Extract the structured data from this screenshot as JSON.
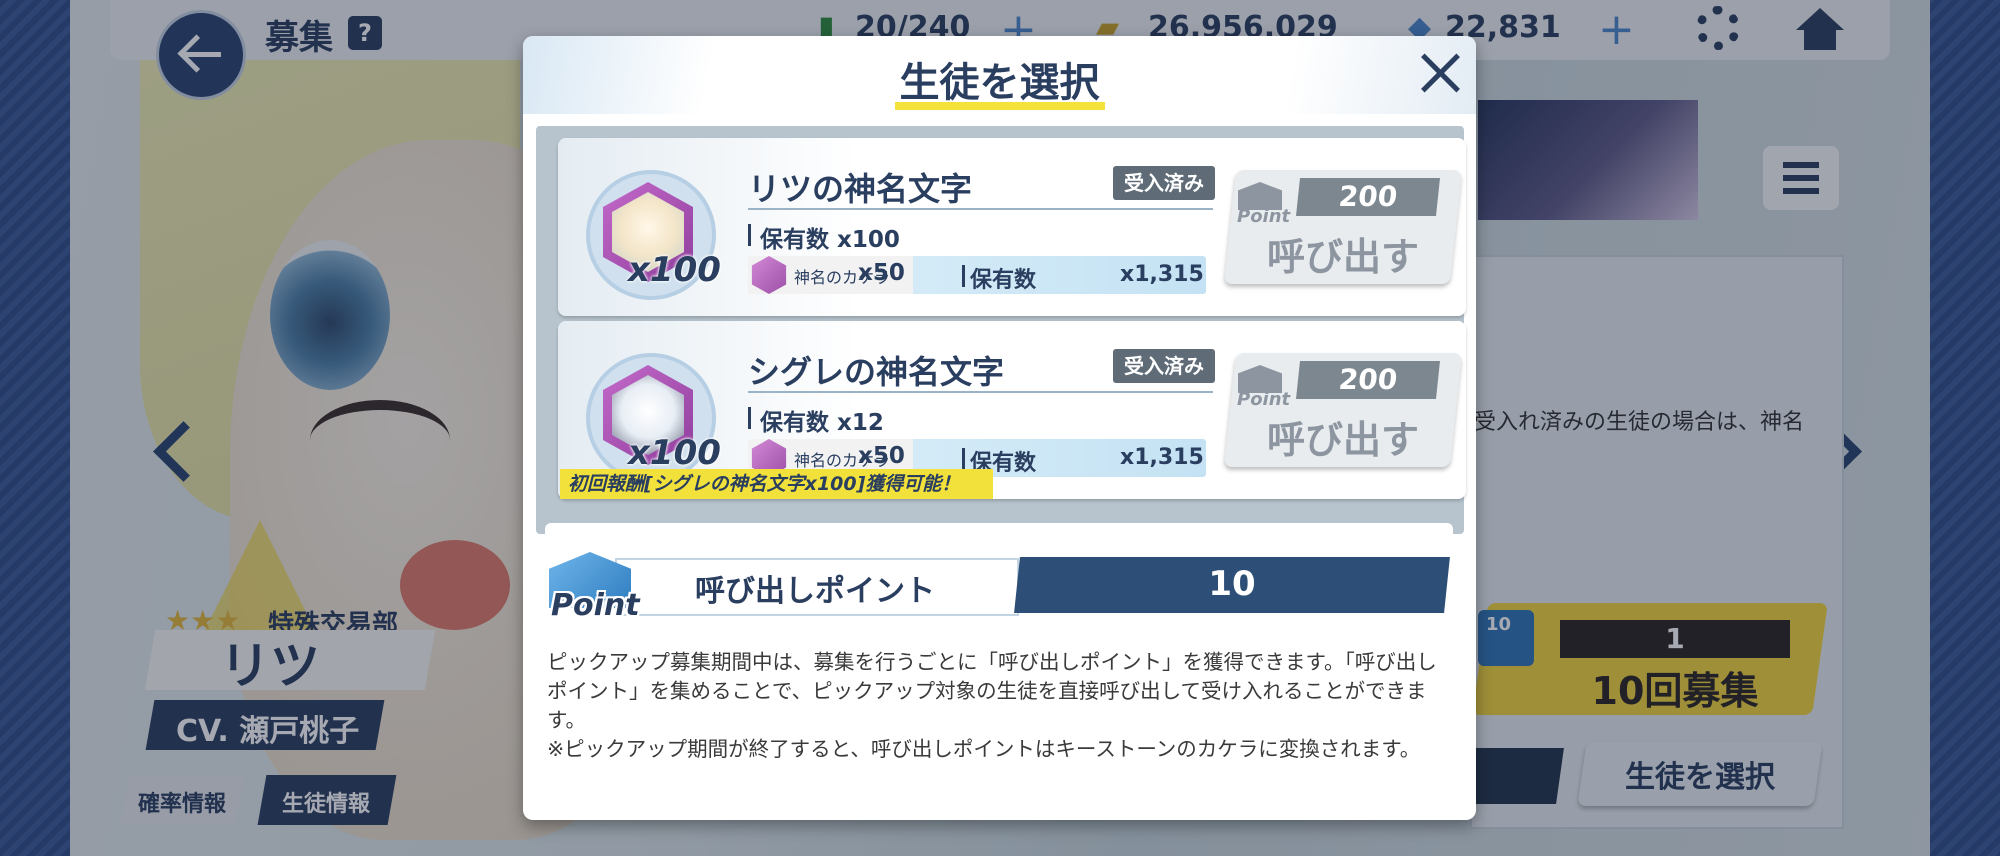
{
  "header": {
    "title": "募集",
    "help": "?",
    "ap": "20/240",
    "credits": "26,956,029",
    "pyroxene": "22,831"
  },
  "character": {
    "stars": "★★★",
    "school": "特殊交易部",
    "name": "リツ",
    "cv": "CV. 瀬戸桃子",
    "tab_rate": "確率情報",
    "tab_student": "生徒情報"
  },
  "side": {
    "partial_text": "受入れ済みの生徒の場合は、神名",
    "ten_count": "1",
    "ten_badge": "10",
    "ten_label": "10回募集",
    "select_label": "生徒を選択"
  },
  "modal": {
    "title": "生徒を選択",
    "items": [
      {
        "multiplier": "x100",
        "name": "リツの神名文字",
        "badge": "受入済み",
        "owned": "保有数 x100",
        "eleph_name": "神名のカケラ",
        "eleph_count": "x50",
        "eleph_owned_label": "保有数",
        "eleph_owned": "x1,315",
        "point_icon_label": "Point",
        "cost": "200",
        "button": "呼び出す"
      },
      {
        "multiplier": "x100",
        "name": "シグレの神名文字",
        "badge": "受入済み",
        "owned": "保有数 x12",
        "eleph_name": "神名のカケラ",
        "eleph_count": "x50",
        "eleph_owned_label": "保有数",
        "eleph_owned": "x1,315",
        "point_icon_label": "Point",
        "cost": "200",
        "button": "呼び出す",
        "reward": "初回報酬[シグレの神名文字x100]獲得可能！"
      }
    ],
    "point_word": "Point",
    "point_label": "呼び出しポイント",
    "point_value": "10",
    "description": "ピックアップ募集期間中は、募集を行うごとに「呼び出しポイント」を獲得できます。「呼び出しポイント」を集めることで、ピックアップ対象の生徒を直接呼び出して受け入れることができます。",
    "note": "※ピックアップ期間が終了すると、呼び出しポイントはキーストーンのカケラに変換されます。"
  }
}
